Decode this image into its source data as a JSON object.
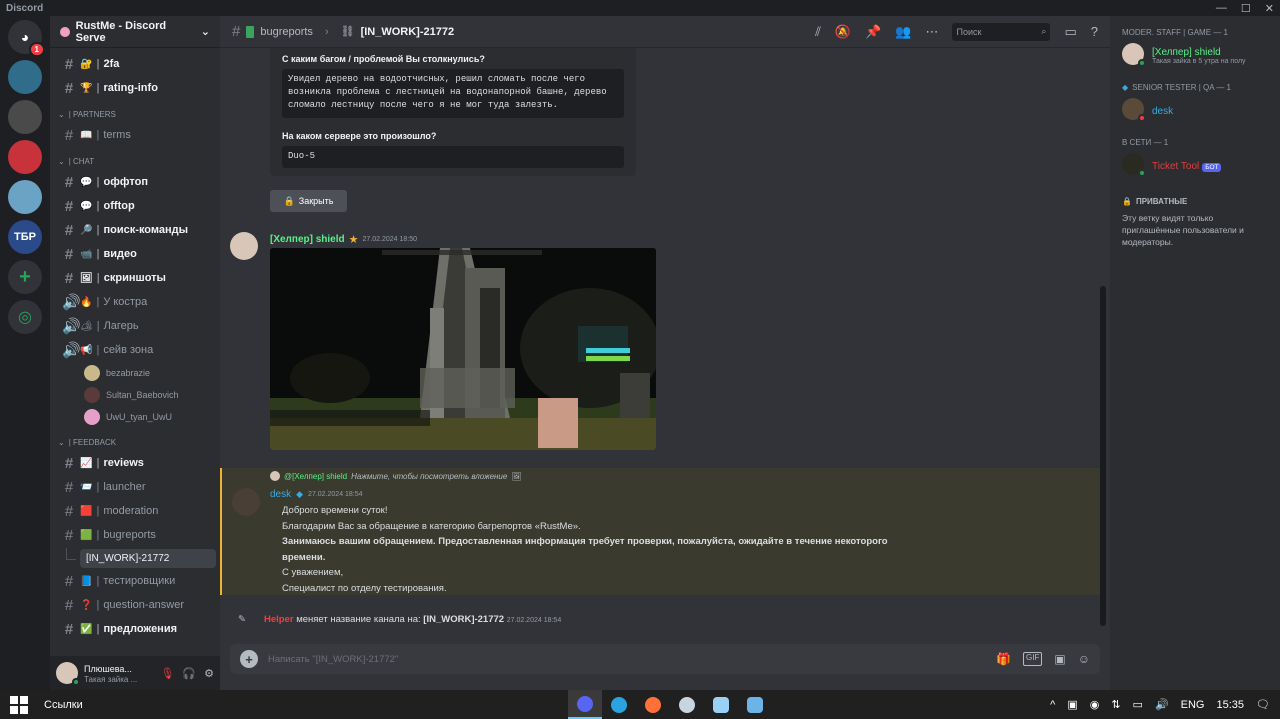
{
  "window": {
    "app_title": "Discord"
  },
  "guilds": [
    {
      "name": "Discord Home",
      "badge": "1",
      "color": "#313338"
    },
    {
      "name": "Server A",
      "color": "#2f6d8a"
    },
    {
      "name": "Server B",
      "color": "#4a4a4a"
    },
    {
      "name": "RustMe",
      "color": "#c8323a",
      "active": true
    },
    {
      "name": "Server D",
      "color": "#6aa3c4"
    },
    {
      "name": "ТБР",
      "label": "ТБР",
      "color": "#2a4a8a"
    },
    {
      "name": "Add a Server",
      "label": "+",
      "color": "#313338"
    },
    {
      "name": "Discover",
      "color": "#313338"
    }
  ],
  "server": {
    "name": "RustMe - Discord Serve"
  },
  "channels": {
    "items": [
      {
        "label": "2fa",
        "emoji": "🔐",
        "unread": true
      },
      {
        "label": "rating-info",
        "emoji": "🏆",
        "unread": true
      }
    ],
    "cat_partners": "| PARTNERS",
    "partners": [
      {
        "label": "terms",
        "emoji": "📖"
      }
    ],
    "cat_chat": "| CHAT",
    "chat": [
      {
        "label": "оффтоп",
        "emoji": "💬",
        "unread": true
      },
      {
        "label": "offtop",
        "emoji": "💬",
        "unread": true
      },
      {
        "label": "поиск-команды",
        "emoji": "🔎",
        "unread": true
      },
      {
        "label": "видео",
        "emoji": "📹",
        "unread": true
      },
      {
        "label": "скриншоты",
        "emoji": "🖼",
        "unread": true
      }
    ],
    "voice": [
      {
        "label": "У костра",
        "emoji": "🔥"
      },
      {
        "label": "Лагерь",
        "emoji": "🏕"
      },
      {
        "label": "сейв зона",
        "emoji": "📢"
      }
    ],
    "voice_users": [
      {
        "name": "bezabrazie",
        "color": "#c9b88c"
      },
      {
        "name": "Sultan_Baebovich",
        "color": "#5a3a3a"
      },
      {
        "name": "UwU_tyan_UwU",
        "color": "#e4a0c8"
      }
    ],
    "cat_feedback": "| FEEDBACK",
    "feedback": [
      {
        "label": "reviews",
        "emoji": "📈",
        "unread": true
      },
      {
        "label": "launcher",
        "emoji": "📨"
      },
      {
        "label": "moderation",
        "emoji": "🟥"
      },
      {
        "label": "bugreports",
        "emoji": "🟩"
      }
    ],
    "thread": "[IN_WORK]-21772",
    "after": [
      {
        "label": "тестировщики",
        "emoji": "📘"
      },
      {
        "label": "question-answer",
        "emoji": "❓"
      },
      {
        "label": "предложения",
        "emoji": "✅",
        "unread": true
      }
    ]
  },
  "userbar": {
    "name": "Плюшева...",
    "status": "Такая зайка ..."
  },
  "header": {
    "channel": "bugreports",
    "thread": "[IN_WORK]-21772",
    "search_placeholder": "Поиск"
  },
  "embed": {
    "q1": "С каким багом / проблемой Вы столкнулись?",
    "a1_lines": [
      "Увидел дерево на водоотчисных, решил сломать после чего",
      "возникла проблема с лестницей на водонапорной башне, дерево",
      "сломало лестницу после чего я не мог туда залезть."
    ],
    "q2": "На каком сервере это произошло?",
    "a2": "Duo-5",
    "close_label": "Закрыть"
  },
  "msg1": {
    "author": "[Хелпер] shield",
    "timestamp": "27.02.2024 18:50"
  },
  "reply": {
    "ref_author": "@[Хелпер] shield",
    "ref_text": "Нажмите, чтобы посмотреть вложение",
    "author": "desk",
    "timestamp": "27.02.2024 18:54",
    "lines": [
      {
        "text": "Доброго времени суток!",
        "bold": false
      },
      {
        "text": "Благодарим Вас за обращение в категорию багрепортов «RustMe».",
        "bold": false
      },
      {
        "text": "Занимаюсь вашим обращением. Предоставленная информация требует проверки, пожалуйста, ожидайте в течение некоторого",
        "bold": true
      },
      {
        "text": "времени.",
        "bold": true
      },
      {
        "text": "С уважением,",
        "bold": false
      },
      {
        "text": "Специалист по отделу тестирования.",
        "bold": false
      }
    ]
  },
  "system": {
    "actor": "Helper",
    "action": "меняет название канала на:",
    "new_name": "[IN_WORK]-21772",
    "timestamp": "27.02.2024 18:54"
  },
  "composer": {
    "placeholder": "Написать \"[IN_WORK]-21772\""
  },
  "members": {
    "groups": [
      {
        "title": "MODER. STAFF | GAME — 1",
        "members": [
          {
            "name": "[Хелпер] shield",
            "status": "Такая зайка в 5 утра на полу",
            "color": "#57f287",
            "presence": "#23a55a",
            "avatar": "#d8c7b8"
          }
        ]
      },
      {
        "title": "SENIOR TESTER | QA — 1",
        "members": [
          {
            "name": "desk",
            "status": "",
            "color": "#3ba9e0",
            "presence": "#f23f43",
            "avatar": "#5a4a3a"
          }
        ]
      },
      {
        "title": "В СЕТИ — 1",
        "members": [
          {
            "name": "Ticket Tool",
            "status": "",
            "color": "#e23c3c",
            "presence": "#23a55a",
            "avatar": "#2a2a20",
            "bot": "БОТ"
          }
        ]
      }
    ],
    "private_title": "ПРИВАТНЫЕ",
    "private_note": "Эту ветку видят только приглашённые пользователи и модераторы."
  },
  "taskbar": {
    "search": "Ссылки",
    "lang": "ENG",
    "time": "15:35"
  },
  "colors": {
    "helper_green": "#57f287",
    "helper_red": "#f23f43",
    "desk_blue": "#3ba9e0",
    "mention_bg": "#3a3a2e"
  }
}
